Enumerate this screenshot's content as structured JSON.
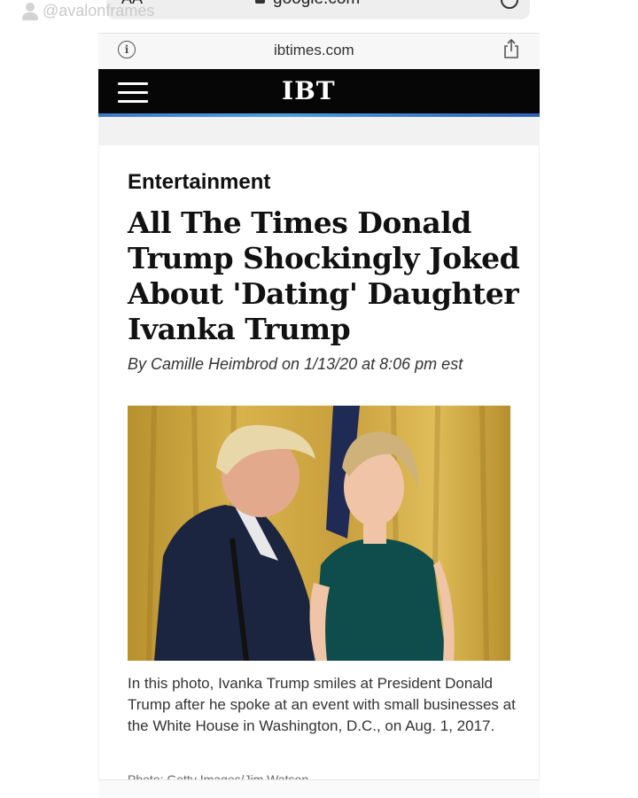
{
  "watermark": {
    "text": "@avalonframes",
    "icon": "person-icon"
  },
  "safari_top": {
    "aa_label": "AA",
    "domain": "google.com",
    "icons": [
      "lock-icon",
      "reload-icon"
    ]
  },
  "address_bar": {
    "domain": "ibtimes.com",
    "icons": [
      "info-icon",
      "share-icon"
    ]
  },
  "site_header": {
    "logo": "IBT",
    "menu_icon": "hamburger-icon",
    "colors": {
      "header_bg": "#060606",
      "stripe": "#3a78c9"
    }
  },
  "article": {
    "category": "Entertainment",
    "headline": "All The Times Donald Trump Shockingly Joked About 'Dating' Daughter Ivanka Trump",
    "byline": "By Camille Heimbrod on 1/13/20 at 8:06 pm est",
    "caption": "In this photo, Ivanka Trump smiles at President Donald Trump after he spoke at an event with small businesses at the White House in Washington, D.C., on Aug. 1, 2017.",
    "credit": "Photo: Getty Images/Jim Watson"
  }
}
